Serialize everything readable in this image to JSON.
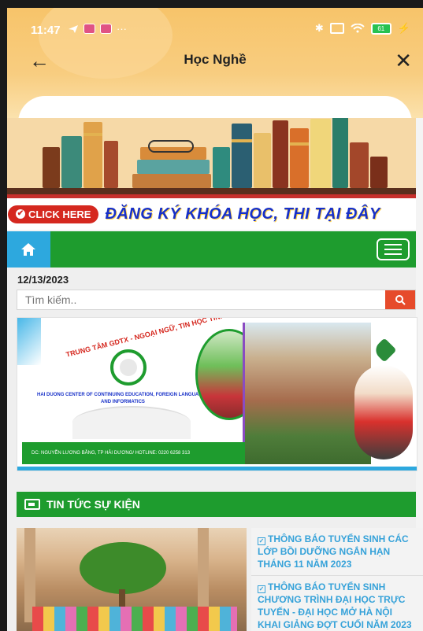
{
  "status_bar": {
    "time": "11:47",
    "more": "···",
    "battery": "61"
  },
  "title_bar": {
    "title": "Học Nghề",
    "back_icon": "arrow-left-icon",
    "close_icon": "close-icon"
  },
  "banner": {
    "click_label": "CLICK HERE",
    "register_text": "ĐĂNG KÝ KHÓA HỌC, THI TẠI ĐÂY"
  },
  "navbar": {
    "home_icon": "home-icon",
    "menu_icon": "hamburger-menu-icon"
  },
  "date": "12/13/2023",
  "search": {
    "placeholder": "Tìm kiếm.."
  },
  "hero": {
    "arc_text": "TRUNG TÂM GDTX - NGOẠI NGỮ, TIN HỌC TỈNH HẢI DƯƠNG",
    "center_name": "HAI DUONG CENTER OF CONTINUING EDUCATION, FOREIGN LANGUAGES AND INFORMATICS",
    "address": "DC: NGUYỄN LƯƠNG BẰNG, TP HẢI DƯƠNG/ HOTLINE: 0220 6258 313"
  },
  "news": {
    "section_title": "TIN TỨC SỰ KIỆN",
    "items": [
      {
        "title": "THÔNG BÁO TUYỂN SINH CÁC LỚP BỒI DƯỠNG NGẮN HẠN THÁNG 11 NĂM 2023"
      },
      {
        "title": "THÔNG BÁO TUYỂN SINH CHƯƠNG TRÌNH ĐẠI HỌC TRỰC TUYẾN - ĐẠI HỌC MỞ HÀ NỘI KHAI GIẢNG ĐỢT CUỐI NĂM 2023"
      }
    ]
  },
  "colors": {
    "header": "#f7c46a",
    "nav_green": "#1e9c2e",
    "home_blue": "#2da8de",
    "search_red": "#e64b2b",
    "link_blue": "#36a2d9"
  }
}
